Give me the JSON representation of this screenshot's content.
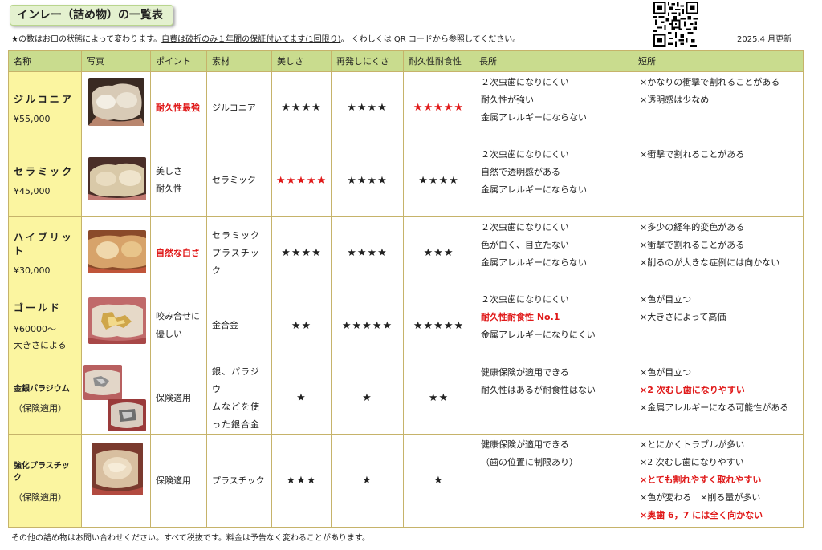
{
  "title": "インレー（詰め物）の一覧表",
  "notice_prefix": "★の数はお口の状態によって変わります。",
  "notice_underline": "自費は破折のみ１年間の保証付いてます(1回限り)",
  "notice_suffix": "。 くわしくは QR コードから参照してください。",
  "updated": "2025.4 月更新",
  "headers": [
    "名称",
    "写真",
    "ポイント",
    "素材",
    "美しさ",
    "再発しにくさ",
    "耐久性耐食性",
    "長所",
    "短所"
  ],
  "rows": [
    {
      "name": "ジルコニア",
      "price": "¥55,000",
      "extra": "",
      "point": [
        "耐久性最強"
      ],
      "material": [
        "ジルコニア"
      ],
      "beauty": "★★★★",
      "recurrence": "★★★★",
      "durability": "★★★★★",
      "pros": [
        "２次虫歯になりにくい",
        "耐久性が強い",
        "金属アレルギーにならない"
      ],
      "cons": [
        "×かなりの衝撃で割れることがある",
        "×透明感は少なめ"
      ]
    },
    {
      "name": "セラミック",
      "price": "¥45,000",
      "extra": "",
      "point": [
        "美しさ",
        "耐久性"
      ],
      "material": [
        "セラミック"
      ],
      "beauty": "★★★★★",
      "recurrence": "★★★★",
      "durability": "★★★★",
      "pros": [
        "２次虫歯になりにくい",
        "自然で透明感がある",
        "金属アレルギーにならない"
      ],
      "cons": [
        "×衝撃で割れることがある"
      ]
    },
    {
      "name": "ハイブリット",
      "price": "¥30,000",
      "extra": "",
      "point": [
        "自然な白さ"
      ],
      "material": [
        "セラミック",
        "プラスチック"
      ],
      "beauty": "★★★★",
      "recurrence": "★★★★",
      "durability": "★★★",
      "pros": [
        "２次虫歯になりにくい",
        "色が白く、目立たない",
        "金属アレルギーにならない"
      ],
      "cons": [
        "×多少の経年的変色がある",
        "×衝撃で割れることがある",
        "×削るのが大きな症例には向かない"
      ]
    },
    {
      "name": "ゴールド",
      "price": "¥60000～",
      "extra": "大きさによる",
      "point": [
        "咬み合せに",
        "優しい"
      ],
      "material": [
        "金合金"
      ],
      "beauty": "★★",
      "recurrence": "★★★★★",
      "durability": "★★★★★",
      "pros": [
        "２次虫歯になりにくい",
        "耐久性耐食性 No.1",
        "金属アレルギーになりにくい"
      ],
      "cons": [
        "×色が目立つ",
        "×大きさによって高価"
      ]
    },
    {
      "name": "金銀パラジウム",
      "price": "（保険適用）",
      "extra": "",
      "point": [
        "保険適用"
      ],
      "material": [
        "銀、パラジウ",
        "ムなどを使",
        "った銀合金"
      ],
      "beauty": "★",
      "recurrence": "★",
      "durability": "★★",
      "pros": [
        "健康保険が適用できる",
        "耐久性はあるが耐食性はない"
      ],
      "cons": [
        "×色が目立つ",
        "×2 次むし歯になりやすい",
        "×金属アレルギーになる可能性がある"
      ]
    },
    {
      "name": "強化プラスチック",
      "price": "（保険適用）",
      "extra": "",
      "point": [
        "保険適用"
      ],
      "material": [
        "プラスチック"
      ],
      "beauty": "★★★",
      "recurrence": "★",
      "durability": "★",
      "pros": [
        "健康保険が適用できる",
        "（歯の位置に制限あり）"
      ],
      "cons": [
        "×とにかくトラブルが多い",
        "×2 次むし歯になりやすい",
        "×とても割れやすく取れやすい",
        "×色が変わる　×削る量が多い",
        "×奥歯 6，7 には全く向かない"
      ]
    }
  ],
  "footer": "その他の詰め物はお問い合わせください。すべて税抜です。料金は予告なく変わることがあります。",
  "colors": {
    "header_bg": "#c9dc8e",
    "name_bg": "#fbf5a0",
    "accent_red": "#e01919",
    "title_bg": "#e4f1cf",
    "border": "#c6b36a"
  }
}
